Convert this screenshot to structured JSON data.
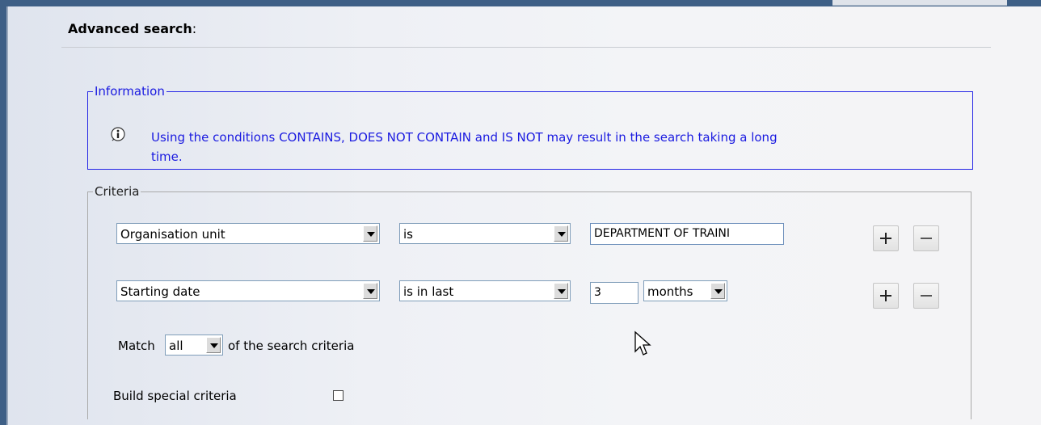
{
  "header": {
    "title": "Advanced search",
    "colon": ":"
  },
  "information": {
    "legend": "Information",
    "icon": "info-icon",
    "message_line1": "Using the conditions CONTAINS, DOES NOT CONTAIN and IS NOT may result in the search taking a long",
    "message_line2": "time."
  },
  "criteria": {
    "legend": "Criteria",
    "rows": [
      {
        "field": "Organisation unit",
        "condition": "is",
        "value": "DEPARTMENT OF TRAINI"
      },
      {
        "field": "Starting date",
        "condition": "is in last",
        "value": "3",
        "unit": "months"
      }
    ],
    "match_prefix": "Match",
    "match_value": "all",
    "match_suffix": "of the search criteria",
    "special_label": "Build special criteria",
    "special_checked": false
  },
  "colors": {
    "info_border": "#2424e6",
    "info_text": "#1a1ae0",
    "frame": "#3e5f86"
  }
}
